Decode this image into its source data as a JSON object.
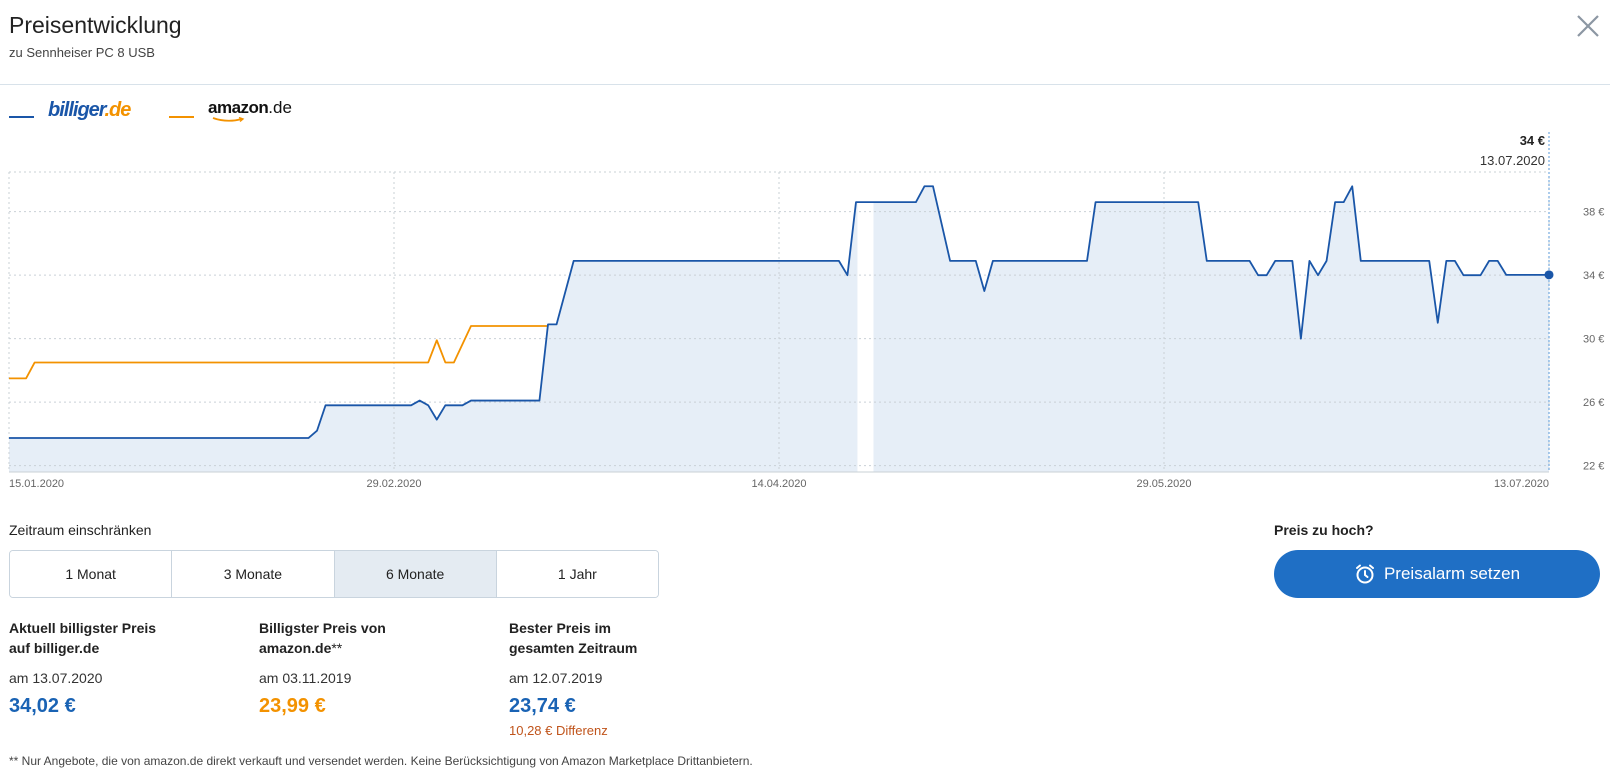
{
  "header": {
    "title": "Preisentwicklung",
    "subtitle": "zu Sennheiser PC 8 USB"
  },
  "legend": {
    "billiger_part1": "billiger",
    "billiger_part2": ".de",
    "amazon_part1": "amazon",
    "amazon_part2": ".de"
  },
  "colors": {
    "billiger": "#1a56a8",
    "amazon": "#f39200",
    "fill": "#e6eef7",
    "accent": "#1f6fc5"
  },
  "chart_data": {
    "type": "line",
    "x_ticks": [
      "15.01.2020",
      "29.02.2020",
      "14.04.2020",
      "29.05.2020",
      "13.07.2020"
    ],
    "y_ticks": [
      "22 €",
      "26 €",
      "30 €",
      "34 €",
      "38 €"
    ],
    "ylim": [
      21.6,
      40.5
    ],
    "xlim": [
      "2020-01-15",
      "2020-07-13"
    ],
    "grid": true,
    "tooltip": {
      "price": "34 €",
      "date": "13.07.2020"
    },
    "series": [
      {
        "name": "billiger.de",
        "points": [
          [
            "2020-01-15",
            23.74
          ],
          [
            "2020-02-19",
            23.74
          ],
          [
            "2020-02-20",
            24.2
          ],
          [
            "2020-02-21",
            25.8
          ],
          [
            "2020-03-02",
            25.8
          ],
          [
            "2020-03-03",
            26.1
          ],
          [
            "2020-03-04",
            25.8
          ],
          [
            "2020-03-05",
            24.9
          ],
          [
            "2020-03-06",
            25.8
          ],
          [
            "2020-03-08",
            25.8
          ],
          [
            "2020-03-09",
            26.1
          ],
          [
            "2020-03-17",
            26.1
          ],
          [
            "2020-03-18",
            30.9
          ],
          [
            "2020-03-19",
            30.9
          ],
          [
            "2020-03-21",
            34.9
          ],
          [
            "2020-04-21",
            34.9
          ],
          [
            "2020-04-22",
            34.0
          ],
          [
            "2020-04-23",
            38.6
          ],
          [
            "2020-04-27",
            38.6
          ],
          [
            "2020-04-30",
            38.6
          ],
          [
            "2020-05-01",
            39.6
          ],
          [
            "2020-05-02",
            39.6
          ],
          [
            "2020-05-04",
            34.9
          ],
          [
            "2020-05-07",
            34.9
          ],
          [
            "2020-05-08",
            33.0
          ],
          [
            "2020-05-09",
            34.9
          ],
          [
            "2020-05-20",
            34.9
          ],
          [
            "2020-05-21",
            38.6
          ],
          [
            "2020-06-02",
            38.6
          ],
          [
            "2020-06-03",
            34.9
          ],
          [
            "2020-06-08",
            34.9
          ],
          [
            "2020-06-09",
            34.0
          ],
          [
            "2020-06-10",
            34.0
          ],
          [
            "2020-06-11",
            34.9
          ],
          [
            "2020-06-13",
            34.9
          ],
          [
            "2020-06-14",
            30.0
          ],
          [
            "2020-06-15",
            34.9
          ],
          [
            "2020-06-16",
            34.0
          ],
          [
            "2020-06-17",
            34.9
          ],
          [
            "2020-06-18",
            38.6
          ],
          [
            "2020-06-19",
            38.6
          ],
          [
            "2020-06-20",
            39.6
          ],
          [
            "2020-06-21",
            34.9
          ],
          [
            "2020-06-29",
            34.9
          ],
          [
            "2020-06-30",
            31.0
          ],
          [
            "2020-07-01",
            34.9
          ],
          [
            "2020-07-02",
            34.9
          ],
          [
            "2020-07-03",
            34.0
          ],
          [
            "2020-07-05",
            34.0
          ],
          [
            "2020-07-06",
            34.9
          ],
          [
            "2020-07-07",
            34.9
          ],
          [
            "2020-07-08",
            34.02
          ],
          [
            "2020-07-13",
            34.02
          ]
        ]
      },
      {
        "name": "amazon.de",
        "points": [
          [
            "2020-01-15",
            27.5
          ],
          [
            "2020-01-17",
            27.5
          ],
          [
            "2020-01-18",
            28.5
          ],
          [
            "2020-03-04",
            28.5
          ],
          [
            "2020-03-05",
            29.9
          ],
          [
            "2020-03-06",
            28.5
          ],
          [
            "2020-03-07",
            28.5
          ],
          [
            "2020-03-09",
            30.8
          ],
          [
            "2020-03-18",
            30.8
          ]
        ]
      }
    ]
  },
  "range": {
    "label": "Zeitraum einschränken",
    "options": [
      "1 Monat",
      "3 Monate",
      "6 Monate",
      "1 Jahr"
    ],
    "selected": "6 Monate"
  },
  "alarm": {
    "question": "Preis zu hoch?",
    "button_label": "Preisalarm setzen"
  },
  "stats": {
    "current": {
      "head_line1": "Aktuell billigster Preis",
      "head_line2": "auf billiger.de",
      "date": "am 13.07.2020",
      "price": "34,02 €"
    },
    "amazon": {
      "head_line1": "Billigster Preis von",
      "head_line2_main": "amazon.de",
      "head_line2_mark": "**",
      "date": "am 03.11.2019",
      "price": "23,99 €"
    },
    "best": {
      "head_line1": "Bester Preis im",
      "head_line2": "gesamten Zeitraum",
      "date": "am 12.07.2019",
      "price": "23,74 €",
      "diff": "10,28 € Differenz"
    }
  },
  "footnote": "** Nur Angebote, die von amazon.de direkt verkauft und versendet werden. Keine Berücksichtigung von Amazon Marketplace Drittanbietern."
}
